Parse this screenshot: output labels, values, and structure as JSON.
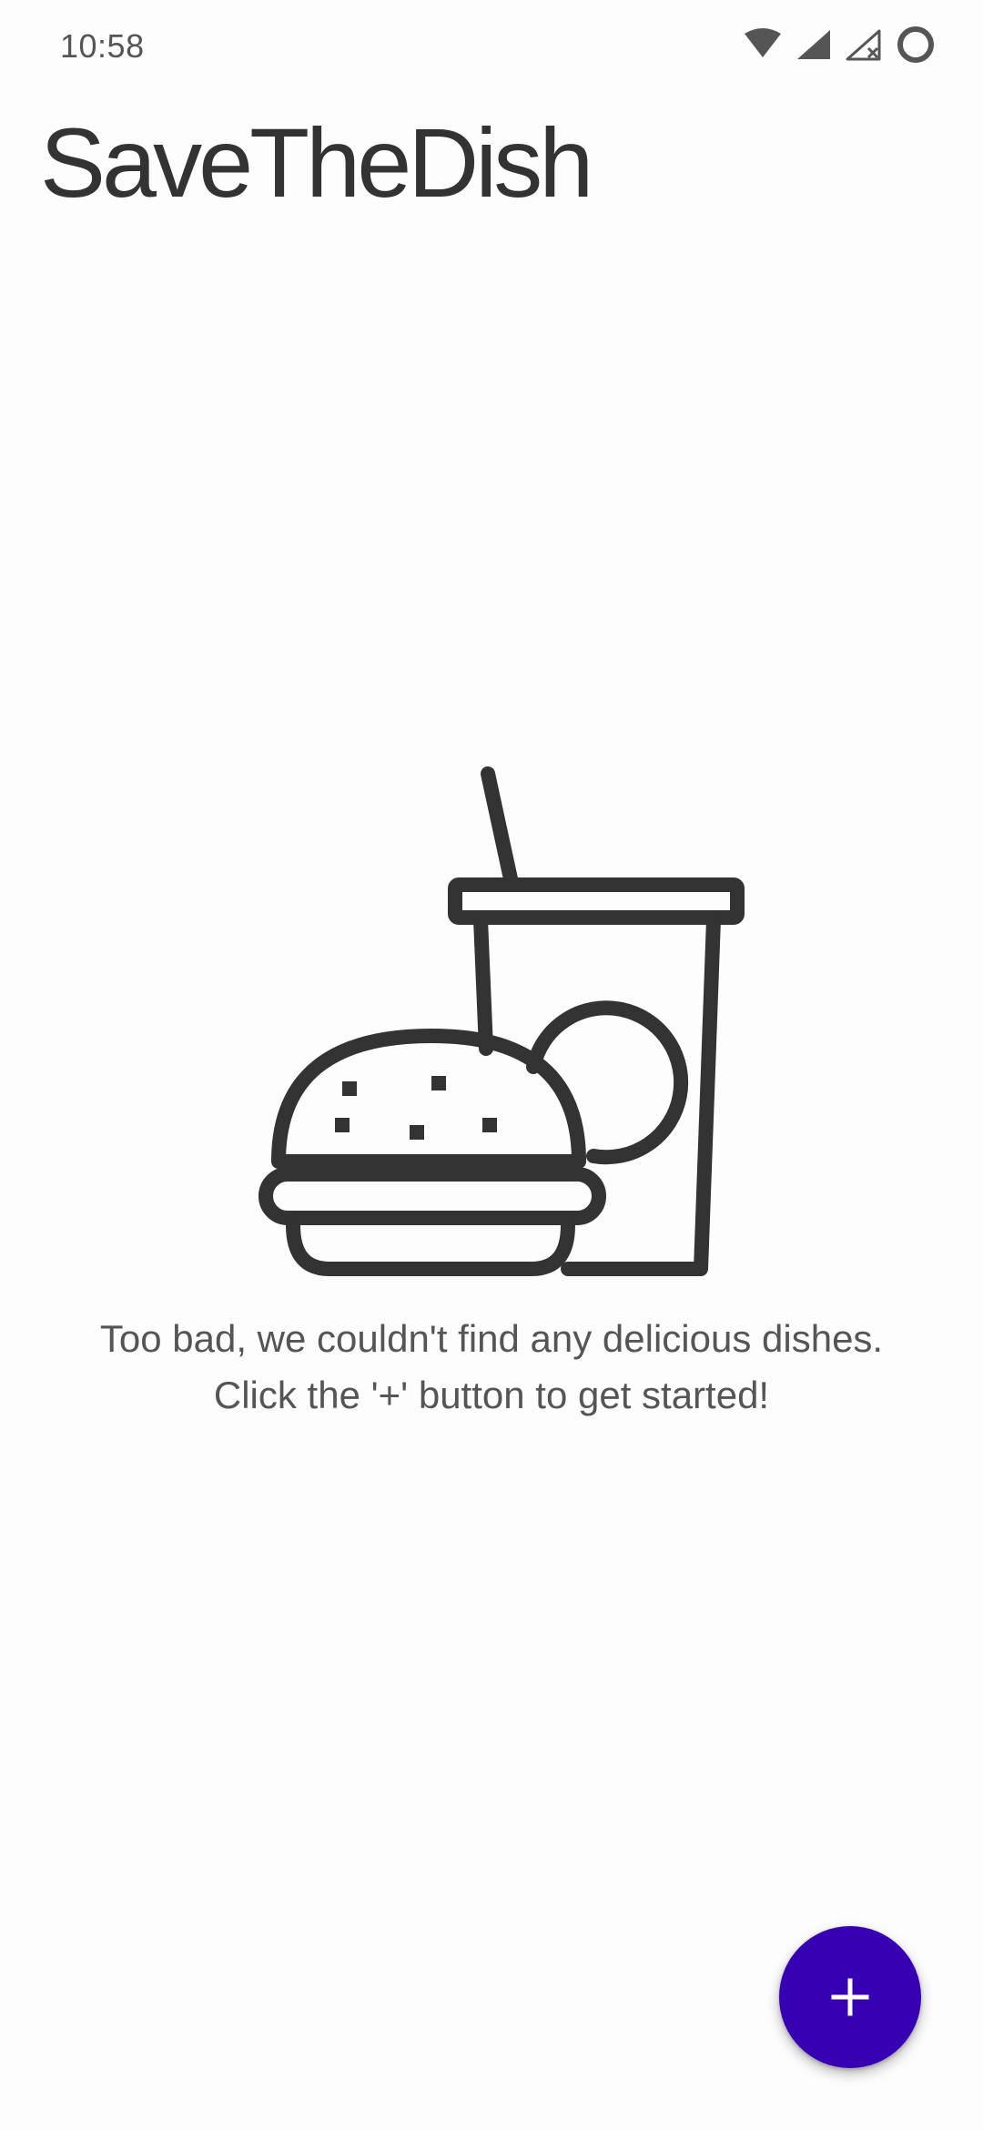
{
  "status_bar": {
    "time": "10:58",
    "icons": [
      "wifi-icon",
      "cell-signal-icon",
      "cell-signal-no-data-icon",
      "battery-icon"
    ]
  },
  "app": {
    "title": "SaveTheDish"
  },
  "empty_state": {
    "illustration": "burger-and-drink-icon",
    "line1": "Too bad, we couldn't find any delicious dishes.",
    "line2": "Click the '+' button to get started!"
  },
  "fab": {
    "icon": "plus-icon",
    "color": "#3700b3"
  },
  "colors": {
    "text": "#333333",
    "muted_text": "#555555",
    "background": "#fdfdfd",
    "accent": "#3700b3"
  }
}
